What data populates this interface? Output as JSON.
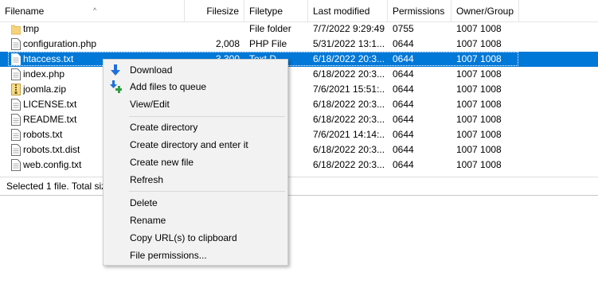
{
  "columns": {
    "filename": "Filename",
    "filesize": "Filesize",
    "filetype": "Filetype",
    "last_modified": "Last modified",
    "permissions": "Permissions",
    "owner_group": "Owner/Group"
  },
  "files": [
    {
      "name": "tmp",
      "size": "",
      "type": "File folder",
      "modified": "7/7/2022 9:29:49",
      "perms": "0755",
      "owner": "1007 1008",
      "icon": "folder-icon"
    },
    {
      "name": "configuration.php",
      "size": "2,008",
      "type": "PHP File",
      "modified": "5/31/2022 13:1...",
      "perms": "0644",
      "owner": "1007 1008",
      "icon": "file-icon"
    },
    {
      "name": "htaccess.txt",
      "size": "3,300",
      "type": "Text D...",
      "modified": "6/18/2022 20:3...",
      "perms": "0644",
      "owner": "1007 1008",
      "icon": "file-icon",
      "selected": true
    },
    {
      "name": "index.php",
      "size": "",
      "type": "",
      "modified": "6/18/2022 20:3...",
      "perms": "0644",
      "owner": "1007 1008",
      "icon": "file-icon"
    },
    {
      "name": "joomla.zip",
      "size": "",
      "type": "e...",
      "modified": "7/6/2021 15:51:...",
      "perms": "0644",
      "owner": "1007 1008",
      "icon": "zip-icon"
    },
    {
      "name": "LICENSE.txt",
      "size": "",
      "type": "",
      "modified": "6/18/2022 20:3...",
      "perms": "0644",
      "owner": "1007 1008",
      "icon": "file-icon"
    },
    {
      "name": "README.txt",
      "size": "",
      "type": "",
      "modified": "6/18/2022 20:3...",
      "perms": "0644",
      "owner": "1007 1008",
      "icon": "file-icon"
    },
    {
      "name": "robots.txt",
      "size": "",
      "type": "",
      "modified": "7/6/2021 14:14:...",
      "perms": "0644",
      "owner": "1007 1008",
      "icon": "file-icon"
    },
    {
      "name": "robots.txt.dist",
      "size": "",
      "type": "",
      "modified": "6/18/2022 20:3...",
      "perms": "0644",
      "owner": "1007 1008",
      "icon": "file-icon"
    },
    {
      "name": "web.config.txt",
      "size": "",
      "type": "",
      "modified": "6/18/2022 20:3...",
      "perms": "0644",
      "owner": "1007 1008",
      "icon": "file-icon"
    }
  ],
  "status_text": "Selected 1 file. Total siz",
  "context_menu": {
    "download": "Download",
    "add_to_queue": "Add files to queue",
    "view_edit": "View/Edit",
    "create_directory": "Create directory",
    "create_directory_enter": "Create directory and enter it",
    "create_new_file": "Create new file",
    "refresh": "Refresh",
    "delete": "Delete",
    "rename": "Rename",
    "copy_urls": "Copy URL(s) to clipboard",
    "file_permissions": "File permissions..."
  },
  "colors": {
    "selection": "#0078d7",
    "download_icon": "#1e6fd9",
    "queue_icon_plus": "#2ea043",
    "folder": "#f6d37a"
  }
}
